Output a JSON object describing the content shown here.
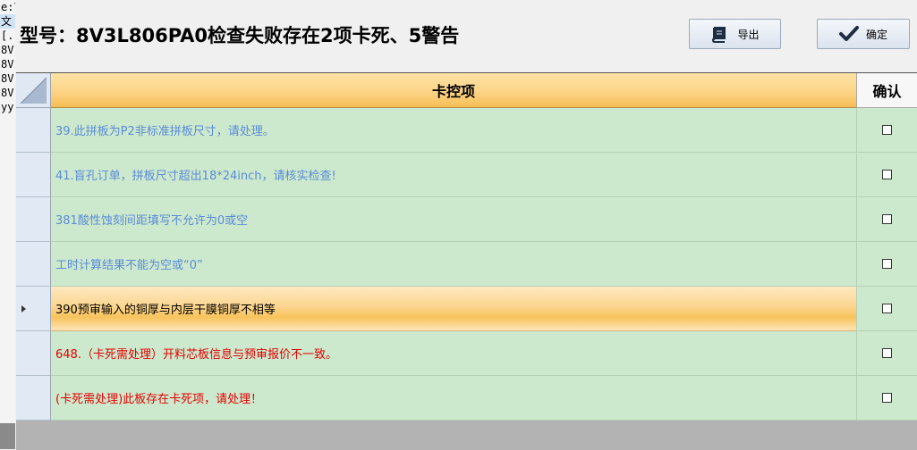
{
  "background_window": {
    "lines": [
      "e:\\",
      "文",
      "[..",
      "8V",
      "8V",
      "8V",
      "8V",
      "yy"
    ]
  },
  "dialog": {
    "title": "型号：8V3L806PA0检查失败存在2项卡死、5警告",
    "buttons": {
      "export": {
        "label": "导出",
        "icon": "book-icon"
      },
      "confirm": {
        "label": "确定",
        "icon": "checkmark-icon"
      }
    }
  },
  "grid": {
    "columns": [
      "卡控项",
      "确认"
    ],
    "rows": [
      {
        "text": "39.此拼板为P2非标准拼板尺寸，请处理。",
        "color": "#5a8bd6",
        "checked": false,
        "current": false
      },
      {
        "text": "41.盲孔订单，拼板尺寸超出18*24inch，请核实检查!",
        "color": "#5a8bd6",
        "checked": false,
        "current": false
      },
      {
        "text": "381酸性蚀刻间距填写不允许为0或空",
        "color": "#5a8bd6",
        "checked": false,
        "current": false
      },
      {
        "text": "工时计算结果不能为空或“0”",
        "color": "#5a8bd6",
        "checked": false,
        "current": false
      },
      {
        "text": "390预审输入的铜厚与内层干膜铜厚不相等",
        "color": "#000000",
        "checked": false,
        "current": true
      },
      {
        "text": "648.（卡死需处理）开料芯板信息与预审报价不一致。",
        "color": "#e00000",
        "checked": false,
        "current": false
      },
      {
        "text": "(卡死需处理)此板存在卡死项，请处理！",
        "color": "#e00000",
        "checked": false,
        "current": false
      }
    ]
  }
}
